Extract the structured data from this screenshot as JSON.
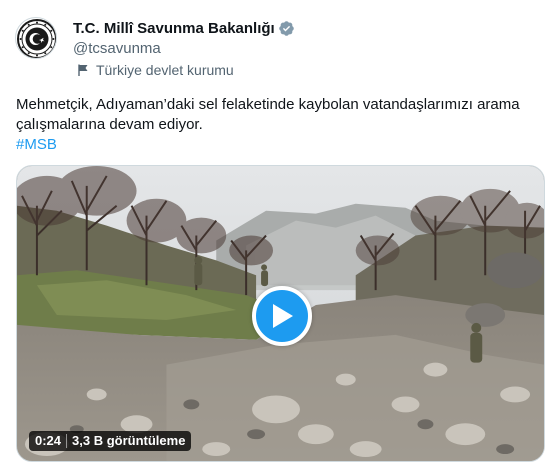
{
  "account": {
    "display_name": "T.C. Millî Savunma Bakanlığı",
    "handle": "@tcsavunma",
    "affiliation": "Türkiye devlet kurumu",
    "verified_icon": "gray-verified-badge-icon",
    "verified_color": "#829aab"
  },
  "tweet": {
    "text": "Mehmetçik, Adıyaman’daki sel felaketinde kaybolan vatandaşlarımızı arama çalışmalarına devam ediyor.",
    "hashtag": "#MSB"
  },
  "video": {
    "duration": "0:24",
    "views": "3,3 B görüntüleme",
    "play_icon": "play-icon"
  },
  "colors": {
    "accent": "#1d9bf0",
    "text": "#0f1419",
    "secondary": "#536471"
  }
}
